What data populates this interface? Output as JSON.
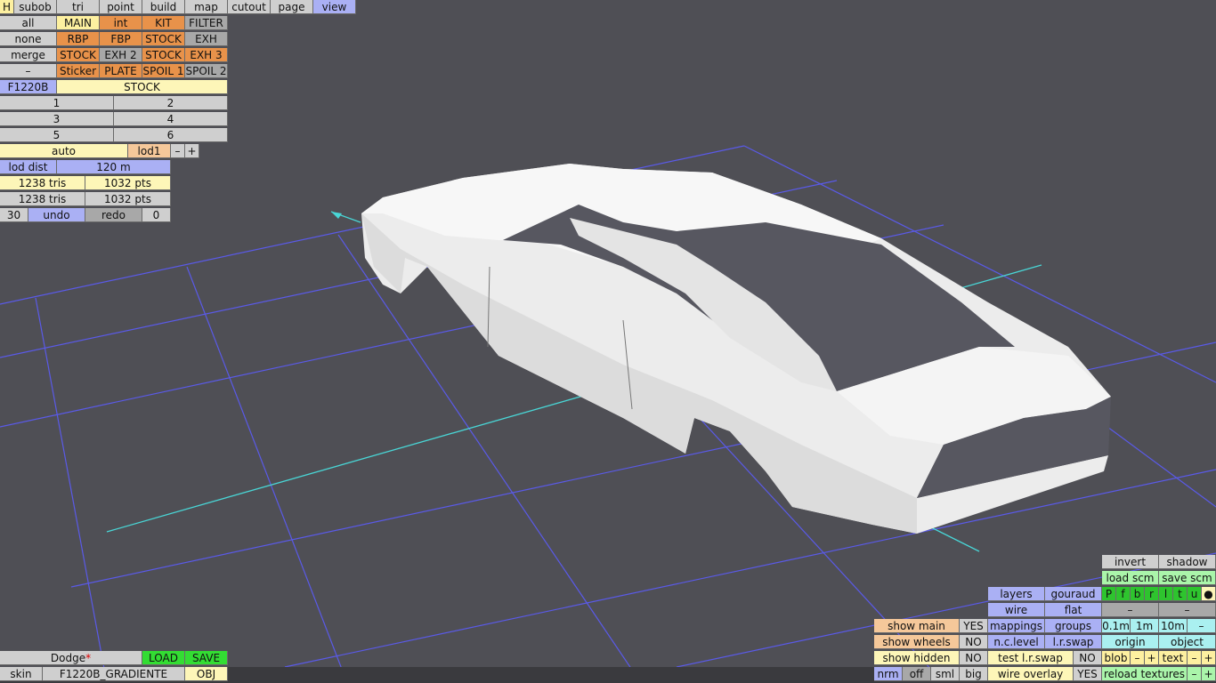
{
  "menu": [
    "H",
    "subob",
    "tri",
    "point",
    "build",
    "map",
    "cutout",
    "page",
    "view"
  ],
  "parts": {
    "row1": [
      "all",
      "MAIN",
      "int",
      "KIT",
      "FILTER"
    ],
    "row2": [
      "none",
      "RBP",
      "FBP",
      "STOCK",
      "EXH"
    ],
    "row3": [
      "merge",
      "STOCK",
      "EXH 2",
      "STOCK",
      "EXH 3"
    ],
    "row4": [
      "–",
      "Sticker",
      "PLATE",
      "SPOIL 1",
      "SPOIL 2"
    ]
  },
  "model": {
    "name": "F1220B",
    "variant": "STOCK"
  },
  "slots": [
    "1",
    "2",
    "3",
    "4",
    "5",
    "6"
  ],
  "lod": {
    "auto": "auto",
    "level": "lod1",
    "minus": "–",
    "plus": "+",
    "dist_label": "lod dist",
    "dist_value": "120 m"
  },
  "stats": {
    "tris1": "1238 tris",
    "pts1": "1032 pts",
    "tris2": "1238 tris",
    "pts2": "1032 pts"
  },
  "history": {
    "count": "30",
    "undo": "undo",
    "redo": "redo",
    "redo_count": "0"
  },
  "project": {
    "name": "Dodge",
    "modified_mark": "*",
    "load": "LOAD",
    "save": "SAVE",
    "skin_label": "skin",
    "skin_value": "F1220B_GRADIENTE",
    "obj": "OBJ"
  },
  "view_panel": {
    "invert": "invert",
    "shadow": "shadow",
    "load_scm": "load scm",
    "save_scm": "save scm",
    "layers": "layers",
    "gouraud": "gouraud",
    "letters": [
      "P",
      "f",
      "b",
      "r",
      "l",
      "t",
      "u",
      "●"
    ],
    "wire": "wire",
    "flat": "flat",
    "dash1": "–",
    "dash2": "–",
    "show_main": "show main",
    "show_main_v": "YES",
    "mappings": "mappings",
    "groups": "groups",
    "d01": "0.1m",
    "d1": "1m",
    "d10": "10m",
    "dminus": "–",
    "show_wheels": "show wheels",
    "show_wheels_v": "NO",
    "nc_level": "n.c.level",
    "lr_swap": "l.r.swap",
    "origin": "origin",
    "object": "object",
    "show_hidden": "show hidden",
    "show_hidden_v": "NO",
    "test_lr_swap": "test l.r.swap",
    "test_lr_v": "NO",
    "blob": "blob",
    "blob_m": "–",
    "blob_p": "+",
    "text": "text",
    "text_m": "–",
    "text_p": "+",
    "nrm": "nrm",
    "off": "off",
    "sml": "sml",
    "big": "big",
    "wire_overlay": "wire overlay",
    "wire_overlay_v": "YES",
    "reload_textures": "reload textures",
    "rt_m": "–",
    "rt_p": "+"
  }
}
